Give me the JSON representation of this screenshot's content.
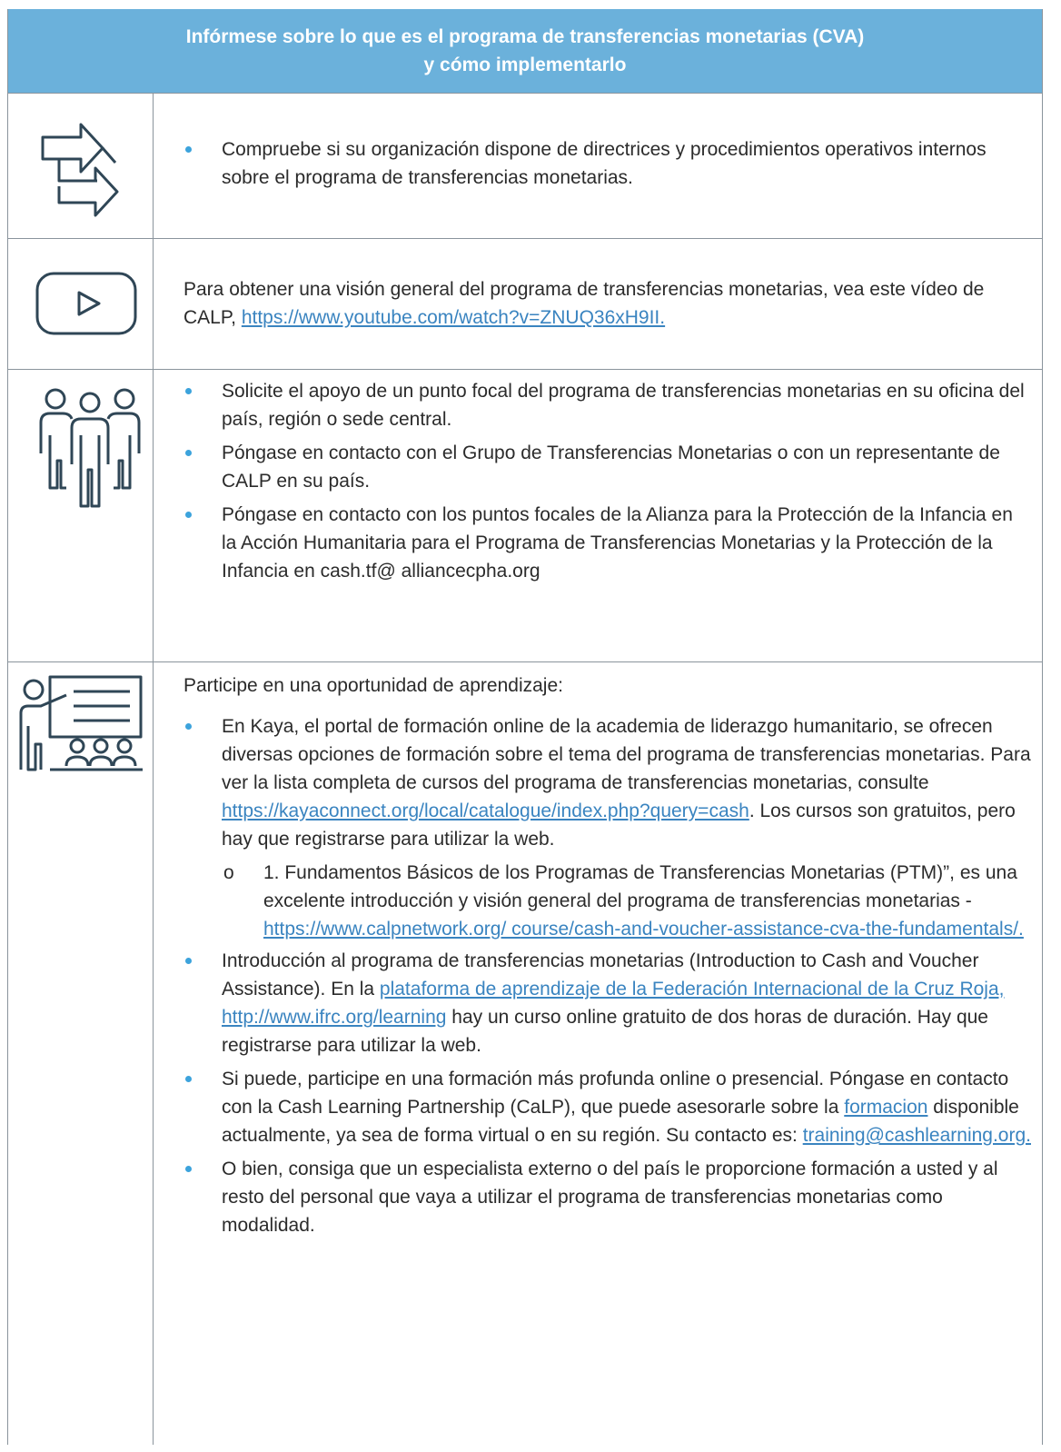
{
  "header": {
    "title_line1": "Infórmese sobre lo que es el programa de transferencias monetarias (CVA)",
    "title_line2": "y cómo implementarlo"
  },
  "icons": {
    "row1": "arrows-icon",
    "row2": "video-play-icon",
    "row3": "people-group-icon",
    "row4": "teacher-presentation-icon"
  },
  "row1": {
    "bullet1": "Compruebe si su organización dispone de directrices y procedimientos operativos internos sobre el programa de transferencias monetarias."
  },
  "row2": {
    "text": "Para obtener una visión general del programa de transferencias monetarias, vea este vídeo de CALP, ",
    "link": "https://www.youtube.com/watch?v=ZNUQ36xH9II."
  },
  "row3": {
    "bullet1": "Solicite el apoyo de un punto focal del programa de transferencias monetarias en su oficina del país, región o sede central.",
    "bullet2": "Póngase en contacto con el Grupo de Transferencias Monetarias o con un representante de CALP en su país.",
    "bullet3": "Póngase en contacto con los puntos focales de la Alianza para la Protección de la Infancia en la Acción Humanitaria para el Programa de Transferencias Monetarias y la Protección de la Infancia en cash.tf@ alliancecpha.org"
  },
  "row4": {
    "intro": "Participe en una oportunidad de aprendizaje:",
    "b1_text": "En Kaya, el portal de formación online de la academia de liderazgo humanitario, se ofrecen diversas opciones de formación sobre el tema del programa de transferencias monetarias. Para ver la lista completa de cursos del programa de transferencias monetarias, consulte ",
    "b1_link": "https://kayaconnect.org/local/catalogue/index.php?query=cash",
    "b1_tail": ". Los cursos son gratuitos, pero hay que registrarse para utilizar la web.",
    "sub_marker": "o",
    "sub_text": "1. Fundamentos Básicos de los Programas de Transferencias Monetarias (PTM)”, es una excelente introducción y visión general del programa de transferencias monetarias - ",
    "sub_link": "https://www.calpnetwork.org/ course/cash-and-voucher-assistance-cva-the-fundamentals/.",
    "b2_text": "Introducción al programa de transferencias monetarias (Introduction to Cash and Voucher Assistance). En la ",
    "b2_link": "plataforma de aprendizaje de la Federación Internacional de la Cruz Roja, http://www.ifrc.org/learning",
    "b2_tail": " hay un curso online gratuito de dos horas de duración.  Hay que registrarse para utilizar la web.",
    "b3_text": "Si puede, participe en una formación más profunda online o presencial. Póngase en contacto con la Cash Learning Partnership (CaLP), que puede asesorarle sobre la ",
    "b3_link1": "formacion",
    "b3_mid": " disponible actualmente, ya sea de forma virtual o en su región. Su contacto es: ",
    "b3_link2": "training@cashlearning.org.",
    "b4_text": "O bien, consiga que un especialista externo o del país le proporcione formación a usted y al resto del personal que vaya a utilizar el programa de transferencias monetarias como modalidad."
  },
  "colors": {
    "header_bg": "#6bb1db",
    "bullet": "#3ca3dc",
    "link": "#3a84c0",
    "icon_stroke": "#2f4656",
    "border": "#8a949c"
  }
}
